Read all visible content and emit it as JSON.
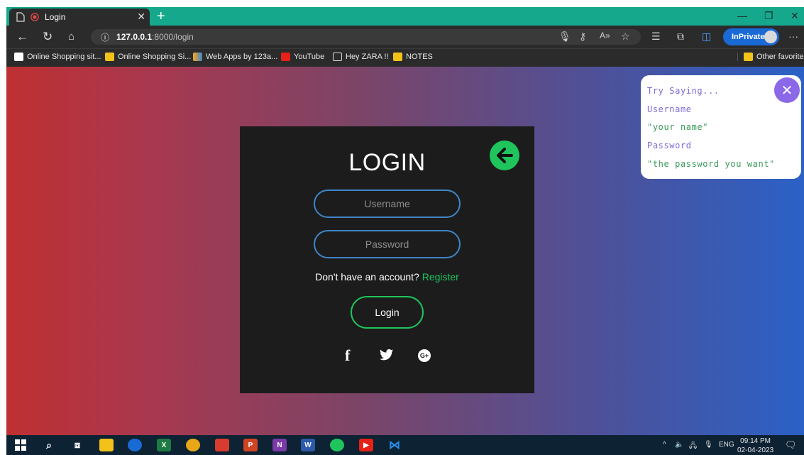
{
  "browser": {
    "tab_title": "Login",
    "url_host": "127.0.0.1",
    "url_path": ":8000/login",
    "inprivate_label": "InPrivate",
    "favorites": [
      "Online Shopping sit...",
      "Online Shopping Si...",
      "Web Apps by 123a...",
      "YouTube",
      "Hey ZARA !!",
      "NOTES"
    ],
    "other_favorites": "Other favorites"
  },
  "login": {
    "title": "LOGIN",
    "username_placeholder": "Username",
    "password_placeholder": "Password",
    "signup_text": "Don't have an account?",
    "register_link": "Register",
    "login_button": "Login",
    "accent_color": "#1fc55c",
    "field_border_color": "#3f86c6"
  },
  "voice_panel": {
    "items": [
      "Try Saying...",
      "Username",
      "\"your name\"",
      "Password",
      "\"the password you want\""
    ],
    "colors": [
      "#7f6ad8",
      "#7f6ad8",
      "#3a9a5a",
      "#7f6ad8",
      "#3a9a5a"
    ]
  },
  "taskbar": {
    "language": "ENG",
    "time": "09:14 PM",
    "date": "02-04-2023"
  }
}
